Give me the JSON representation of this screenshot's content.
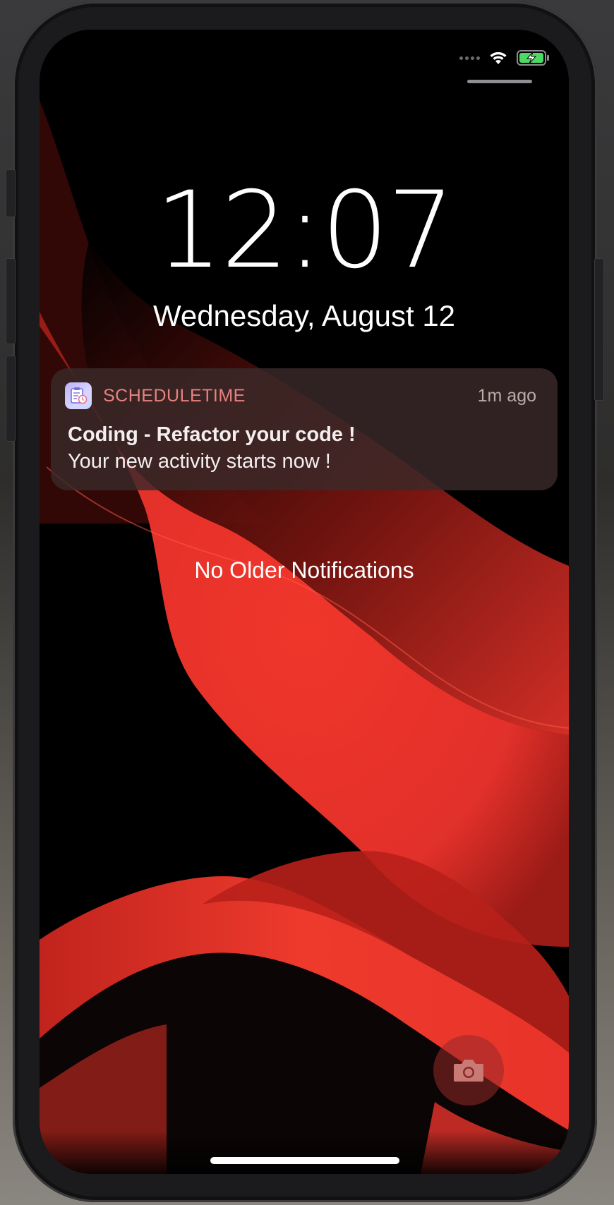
{
  "lock_screen": {
    "time": "12:07",
    "date": "Wednesday, August 12"
  },
  "status_bar": {
    "icons": [
      "cellular-signal-icon",
      "wifi-icon",
      "battery-charging-icon"
    ]
  },
  "notification": {
    "app_name": "SCHEDULETIME",
    "time_ago": "1m ago",
    "title": "Coding - Refactor your code !",
    "body": "Your new activity starts now !",
    "icon": "scheduletime-app-icon"
  },
  "no_older_notifications": "No Older Notifications",
  "quick_actions": {
    "camera_icon": "camera-icon"
  },
  "colors": {
    "wallpaper_red": "#e8332a",
    "app_name": "#e7817f",
    "battery_green": "#4cd964"
  }
}
